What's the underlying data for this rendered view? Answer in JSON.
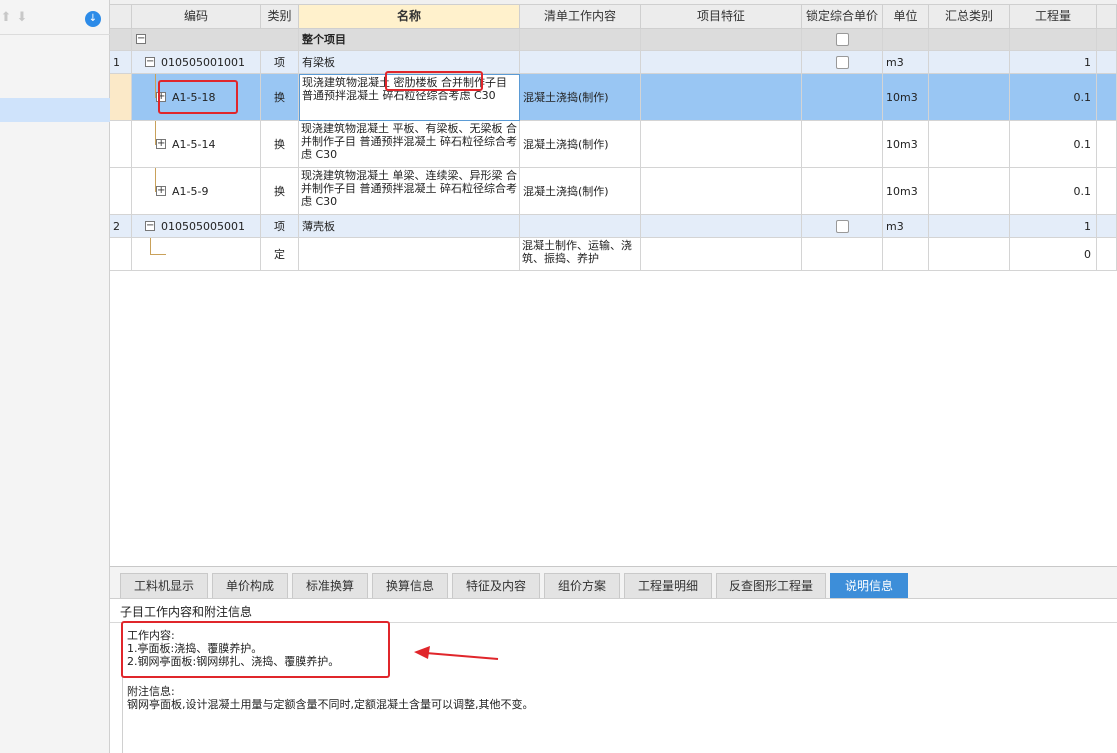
{
  "grid": {
    "headers": {
      "code": "编码",
      "type": "类别",
      "name": "名称",
      "work": "清单工作内容",
      "feature": "项目特征",
      "lock": "锁定综合单价",
      "unit": "单位",
      "summary": "汇总类别",
      "qty": "工程量"
    },
    "group": {
      "toggle": "−",
      "name": "整个项目"
    },
    "rows": [
      {
        "num": "1",
        "toggle": "−",
        "code": "010505001001",
        "type": "项",
        "name": "有梁板",
        "work": "",
        "unit": "m3",
        "qty": "1"
      },
      {
        "num": "",
        "toggle": "+",
        "code": "A1-5-18",
        "type": "换",
        "name": "现浇建筑物混凝土 密肋楼板 合并制作子目 普通预拌混凝土 碎石粒径综合考虑 C30",
        "work": "混凝土浇捣(制作)",
        "unit": "10m3",
        "qty": "0.1"
      },
      {
        "num": "",
        "toggle": "+",
        "code": "A1-5-14",
        "type": "换",
        "name": "现浇建筑物混凝土 平板、有梁板、无梁板 合并制作子目 普通预拌混凝土 碎石粒径综合考虑 C30",
        "work": "混凝土浇捣(制作)",
        "unit": "10m3",
        "qty": "0.1"
      },
      {
        "num": "",
        "toggle": "+",
        "code": "A1-5-9",
        "type": "换",
        "name": "现浇建筑物混凝土 单梁、连续梁、异形梁 合并制作子目 普通预拌混凝土 碎石粒径综合考虑 C30",
        "work": "混凝土浇捣(制作)",
        "unit": "10m3",
        "qty": "0.1"
      },
      {
        "num": "2",
        "toggle": "−",
        "code": "010505005001",
        "type": "项",
        "name": "薄壳板",
        "work": "",
        "unit": "m3",
        "qty": "1"
      },
      {
        "num": "",
        "toggle": "",
        "code": "",
        "type": "定",
        "name": "",
        "work": "混凝土制作、运输、浇筑、振捣、养护",
        "unit": "",
        "qty": "0"
      }
    ]
  },
  "bottom": {
    "tabs": [
      "工料机显示",
      "单价构成",
      "标准换算",
      "换算信息",
      "特征及内容",
      "组价方案",
      "工程量明细",
      "反查图形工程量",
      "说明信息"
    ],
    "active_tab": "说明信息",
    "section_title": "子目工作内容和附注信息",
    "work_label": "工作内容:",
    "work_items": [
      "1.亭面板:浇捣、覆膜养护。",
      "2.钢网亭面板:钢网绑扎、浇捣、覆膜养护。"
    ],
    "note_label": "附注信息:",
    "note_text": "钢网亭面板,设计混凝土用量与定额含量不同时,定额混凝土含量可以调整,其他不变。"
  },
  "colors": {
    "accent": "#3d8ed9",
    "selected_row": "#99c6f3",
    "item_row": "#e4edf9",
    "annotation_red": "#e0262b"
  }
}
